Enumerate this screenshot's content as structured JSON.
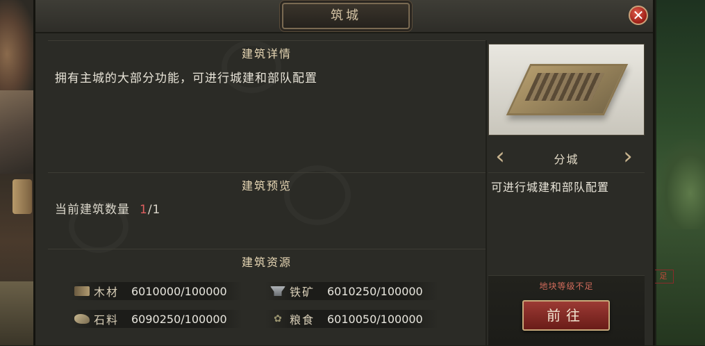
{
  "window": {
    "title": "筑城",
    "close_label": "✕"
  },
  "details": {
    "heading": "建筑详情",
    "description": "拥有主城的大部分功能，可进行城建和部队配置"
  },
  "preview_section": {
    "heading": "建筑预览",
    "count_label": "当前建筑数量",
    "count_current": "1",
    "count_total": "/1"
  },
  "resources": {
    "heading": "建筑资源",
    "items": [
      {
        "name": "木材",
        "value": "6010000/100000",
        "icon": "wood-icon",
        "color": "#a08a64"
      },
      {
        "name": "铁矿",
        "value": "6010250/100000",
        "icon": "anvil-icon",
        "color": "#9aa0a4"
      },
      {
        "name": "石料",
        "value": "6090250/100000",
        "icon": "stone-icon",
        "color": "#b8a888"
      },
      {
        "name": "粮食",
        "value": "6010050/100000",
        "icon": "grain-icon",
        "color": "#8a8464"
      }
    ]
  },
  "selector": {
    "title": "分城",
    "description": "可进行城建和部队配置",
    "prev_symbol": "‹",
    "next_symbol": "›"
  },
  "action": {
    "warning": "地块等级不足",
    "warning_color": "#d06a5a",
    "button_label": "前往",
    "button_color": "#8a2c26"
  },
  "background": {
    "side_tag": "足"
  }
}
